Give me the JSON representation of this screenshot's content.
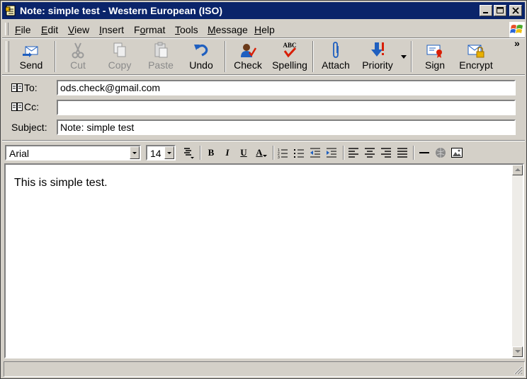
{
  "window": {
    "title": "Note: simple test - Western European (ISO)",
    "controls": {
      "minimize": "minimize",
      "maximize": "maximize",
      "close": "close"
    }
  },
  "menu": [
    {
      "label": "File",
      "hotkey": "F",
      "rest": "ile"
    },
    {
      "label": "Edit",
      "hotkey": "E",
      "rest": "dit"
    },
    {
      "label": "View",
      "hotkey": "V",
      "rest": "iew"
    },
    {
      "label": "Insert",
      "hotkey": "I",
      "rest": "nsert"
    },
    {
      "label": "Format",
      "hotkey": "o",
      "pre": "F",
      "rest": "rmat"
    },
    {
      "label": "Tools",
      "hotkey": "T",
      "rest": "ools"
    },
    {
      "label": "Message",
      "hotkey": "M",
      "rest": "essage"
    },
    {
      "label": "Help",
      "hotkey": "H",
      "rest": "elp"
    }
  ],
  "toolbar": {
    "send": "Send",
    "cut": "Cut",
    "copy": "Copy",
    "paste": "Paste",
    "undo": "Undo",
    "check": "Check",
    "spelling": "Spelling",
    "spelling_icon_text": "ABC",
    "attach": "Attach",
    "priority": "Priority",
    "sign": "Sign",
    "encrypt": "Encrypt",
    "overflow": "»"
  },
  "fields": {
    "to_label": "To:",
    "to_value": "ods.check@gmail.com",
    "cc_label": "Cc:",
    "cc_value": "",
    "subject_label": "Subject:",
    "subject_value": "Note: simple test"
  },
  "format": {
    "font": "Arial",
    "size": "14",
    "bold": "B",
    "italic": "I",
    "underline": "U",
    "font_color": "A"
  },
  "body": {
    "text": "This is simple test."
  },
  "colors": {
    "title_bar": "#0a246a",
    "face": "#d4d0c8",
    "accent_blue": "#1f5fbf",
    "accent_red": "#d81e05"
  }
}
